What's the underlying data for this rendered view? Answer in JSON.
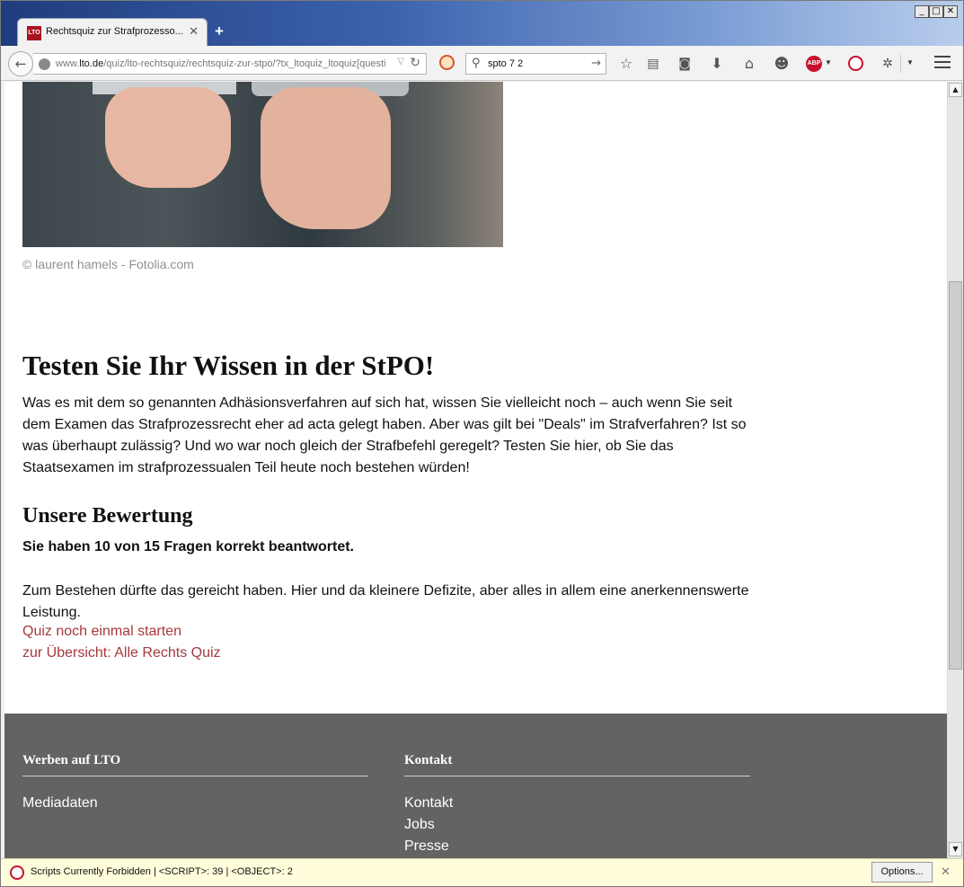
{
  "browser": {
    "tab_title": "Rechtsquiz zur Strafprozesso...",
    "tab_favicon_text": "LTO",
    "tab_close": "✕",
    "new_tab": "+",
    "window_controls": {
      "minimize": "_",
      "maximize": "□",
      "close": "✕"
    },
    "url_prefix": "www.",
    "url_domain": "lto.de",
    "url_path": "/quiz/lto-rechtsquiz/rechtsquiz-zur-stpo/?tx_ltoquiz_ltoquiz[questi",
    "search_value": "spto 7 2",
    "abp_label": "ABP"
  },
  "icons": {
    "back": "back-arrow-icon",
    "site": "globe-icon",
    "reload": "reload-icon",
    "noscript": "noscript-icon",
    "search": "search-icon",
    "bookmark": "star-icon",
    "reading_list": "clipboard-icon",
    "pocket": "pocket-icon",
    "downloads": "download-icon",
    "home": "home-icon",
    "chat": "smiley-icon",
    "adblock": "adblock-icon",
    "noscript_menu": "noscript-menu-icon",
    "extension": "extension-icon",
    "menu": "hamburger-icon"
  },
  "article": {
    "image_credit": "© laurent hamels - Fotolia.com",
    "heading": "Testen Sie Ihr Wissen in der StPO!",
    "intro": "Was es mit dem so genannten Adhäsionsverfahren auf sich hat, wissen Sie vielleicht noch – auch wenn Sie seit dem Examen das Strafprozessrecht eher ad acta gelegt haben. Aber was gilt bei \"Deals\" im Strafverfahren? Ist so was überhaupt zulässig? Und wo war noch gleich der Strafbefehl geregelt? Testen Sie hier, ob Sie das Staatsexamen im strafprozessualen Teil heute noch bestehen würden!",
    "result_heading": "Unsere Bewertung",
    "score": "Sie haben 10 von 15 Fragen korrekt beantwortet.",
    "result_text": "Zum Bestehen dürfte das gereicht haben. Hier und da kleinere Defizite, aber alles in allem eine anerkennenswerte Leistung.",
    "restart_link": "Quiz noch einmal starten",
    "overview_link": "zur Übersicht: Alle Rechts Quiz"
  },
  "footer": {
    "columns": [
      {
        "title": "Werben auf LTO",
        "items": [
          "Mediadaten"
        ]
      },
      {
        "title": "Kontakt",
        "items": [
          "Kontakt",
          "Jobs",
          "Presse"
        ]
      }
    ]
  },
  "notification": {
    "text": "Scripts Currently Forbidden | <SCRIPT>: 39 | <OBJECT>: 2",
    "options_label": "Options...",
    "close": "✕"
  },
  "colors": {
    "link": "#a5393b",
    "footer_bg": "#636363",
    "titlebar_start": "#1f3d7d"
  }
}
